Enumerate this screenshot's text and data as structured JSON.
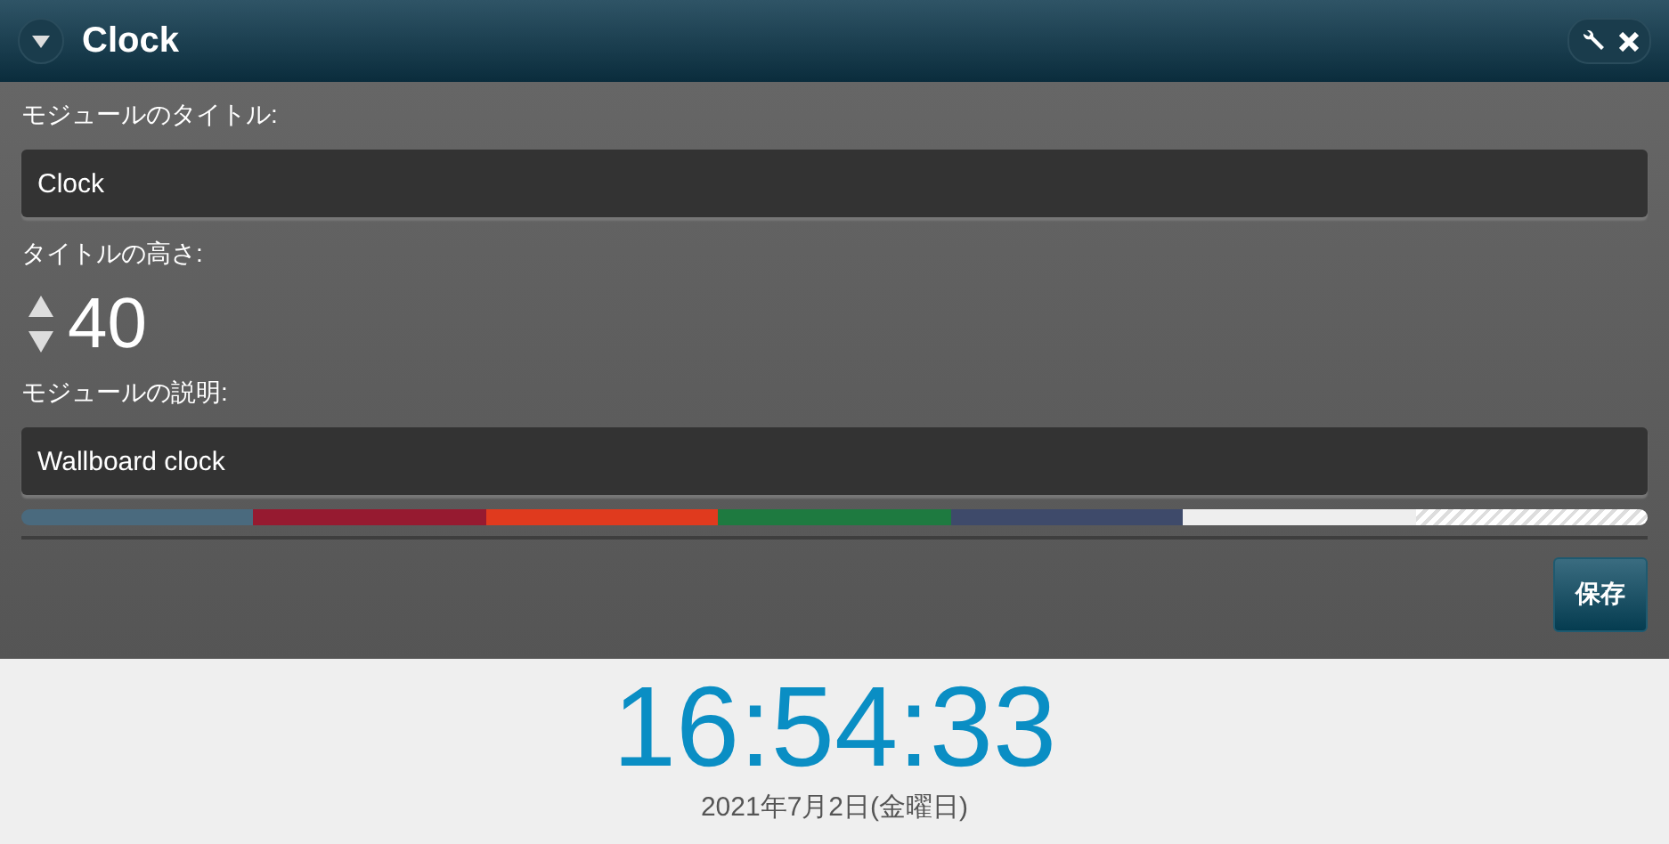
{
  "header": {
    "title": "Clock"
  },
  "form": {
    "title_label": "モジュールのタイトル:",
    "title_value": "Clock",
    "height_label": "タイトルの高さ:",
    "height_value": "40",
    "description_label": "モジュールの説明:",
    "description_value": "Wallboard clock",
    "swatches": [
      {
        "kind": "color",
        "color": "#4a6a7e"
      },
      {
        "kind": "color",
        "color": "#961a30"
      },
      {
        "kind": "color",
        "color": "#e03a1e"
      },
      {
        "kind": "color",
        "color": "#1e7a40"
      },
      {
        "kind": "color",
        "color": "#3e4a6a"
      },
      {
        "kind": "color",
        "color": "#eeeeee"
      },
      {
        "kind": "none"
      }
    ],
    "save_button": "保存"
  },
  "clock": {
    "time": "16:54:33",
    "date": "2021年7月2日(金曜日)"
  }
}
